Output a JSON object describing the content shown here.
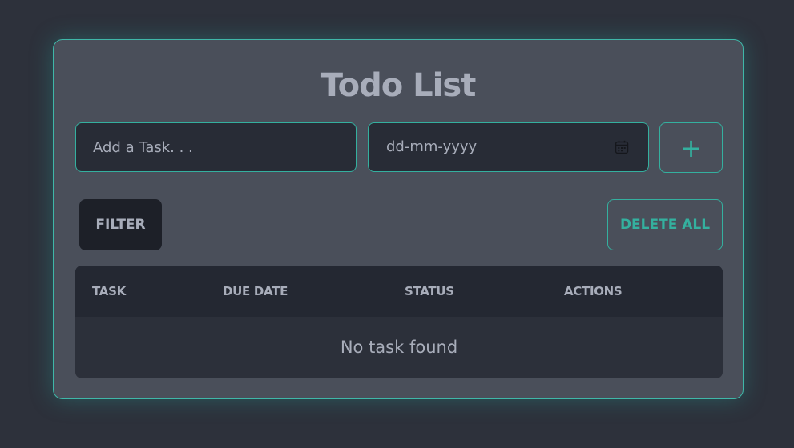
{
  "app": {
    "title": "Todo List"
  },
  "form": {
    "task_placeholder": "Add a Task. . .",
    "task_value": "",
    "date_placeholder": "dd-mm-yyyy",
    "date_icon": "calendar-icon",
    "add_label": "+"
  },
  "controls": {
    "filter_label": "FILTER",
    "delete_all_label": "DELETE ALL"
  },
  "table": {
    "columns": [
      "TASK",
      "DUE DATE",
      "STATUS",
      "ACTIONS"
    ],
    "rows": [],
    "empty_message": "No task found"
  },
  "colors": {
    "background": "#2d313b",
    "card": "#4a4f5a",
    "accent": "#34b09f",
    "text": "#a8adba",
    "input_bg": "#282c36",
    "table_header": "#242832",
    "filter_bg": "#1d2028"
  }
}
